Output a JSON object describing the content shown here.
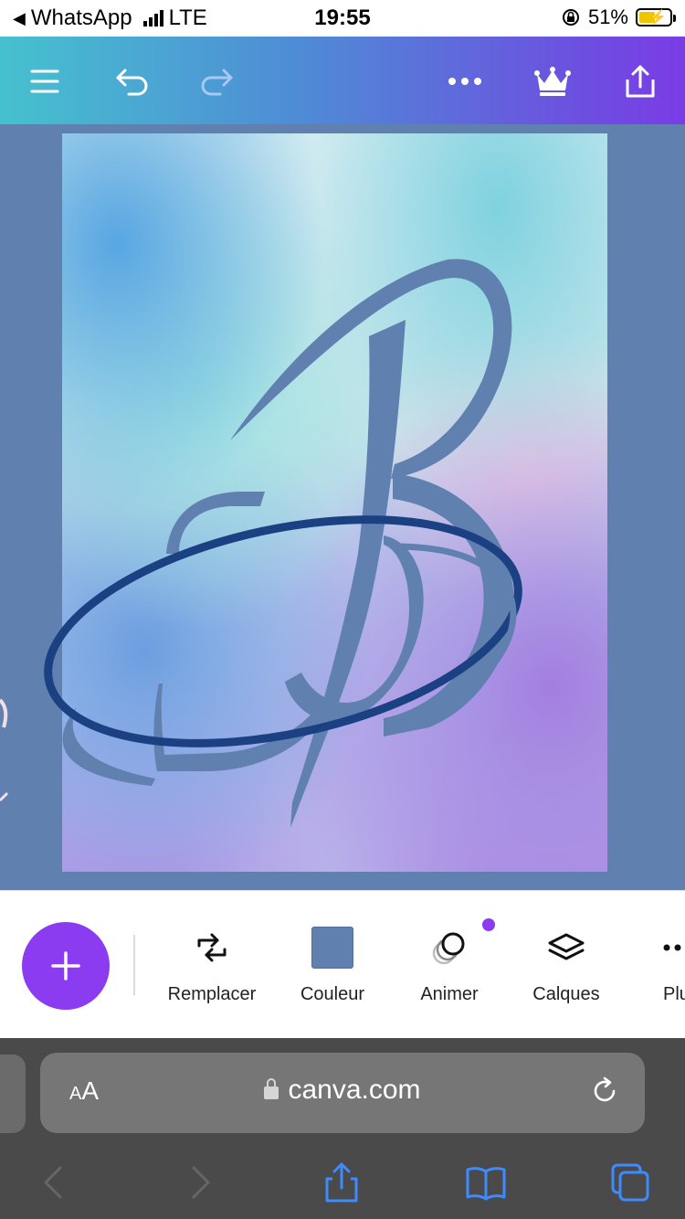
{
  "status_bar": {
    "back_app": "WhatsApp",
    "network": "LTE",
    "time": "19:55",
    "battery": "51%"
  },
  "toolbar": {
    "icons": [
      "menu-icon",
      "undo-icon",
      "redo-icon",
      "more-icon",
      "crown-icon",
      "share-icon"
    ]
  },
  "design": {
    "monogram_letter": "B",
    "letter_color": "#6081b0",
    "ring_color": "#1b4182"
  },
  "bottom_tools": {
    "replace_label": "Remplacer",
    "color_label": "Couleur",
    "animate_label": "Animer",
    "layers_label": "Calques",
    "more_label": "Plu",
    "swatch_color": "#6081b0",
    "accent": "#8b3cf0"
  },
  "browser": {
    "text_size_label_small": "A",
    "text_size_label_large": "A",
    "domain": "canva.com"
  }
}
